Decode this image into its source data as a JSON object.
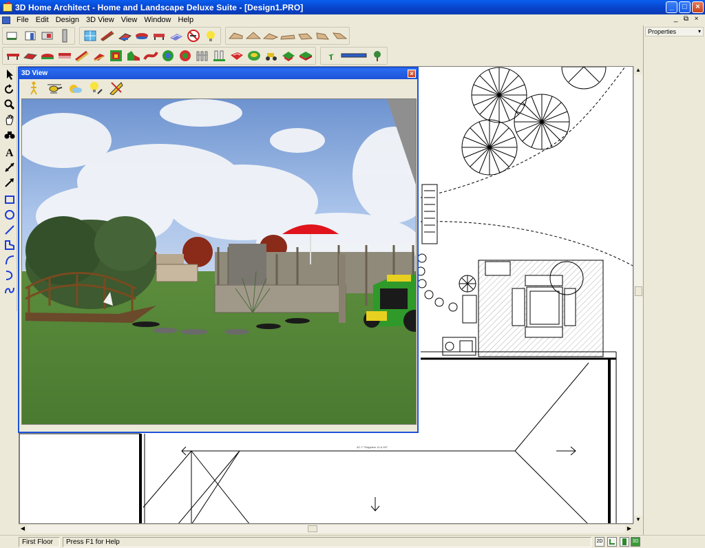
{
  "window": {
    "title": "3D Home Architect - Home and Landscape Deluxe Suite - [Design1.PRO]",
    "minimize": "_",
    "maximize": "□",
    "close": "×"
  },
  "menu": {
    "items": [
      "File",
      "Edit",
      "Design",
      "3D View",
      "View",
      "Window",
      "Help"
    ],
    "mdi_restore": "⧉",
    "mdi_min": "_",
    "mdi_close": "×"
  },
  "toolbar_row1": {
    "group1": [
      "wall-icon",
      "door-icon",
      "window-icon",
      "stairs-icon"
    ],
    "group2": [
      "window-pane-icon",
      "deck-railing-icon",
      "deck-icon",
      "bench-icon",
      "table-icon",
      "paver-icon",
      "no-smoking-icon",
      "light-icon"
    ],
    "group3": [
      "roof-plane-1-icon",
      "roof-plane-2-icon",
      "roof-plane-3-icon",
      "roof-plane-4-icon",
      "roof-plane-5-icon",
      "roof-plane-6-icon",
      "roof-plane-7-icon"
    ]
  },
  "toolbar_row2": {
    "group1": [
      "rail-red-icon",
      "rail-red-2-icon",
      "rail-red-3-icon",
      "rail-red-4-icon",
      "deck-stair-icon",
      "deck-stair-2-icon",
      "planting-bed-icon",
      "terrain-icon",
      "path-icon",
      "ground-icon",
      "shrub-icon",
      "fence-icon",
      "picket-fence-icon",
      "rock-icon",
      "globe-icon",
      "tractor-icon",
      "garden-bed-icon",
      "garden-bed-2-icon"
    ],
    "group2": [
      "sprout-icon",
      "blue-bar-icon",
      "tree-icon"
    ]
  },
  "properties": {
    "label": "Properties",
    "dropdown": "▾"
  },
  "palette": [
    "select-arrow-icon",
    "rotate-icon",
    "zoom-icon",
    "pan-hand-icon",
    "binoculars-icon",
    "text-icon",
    "dimension-icon",
    "line-arrow-icon",
    "rectangle-icon",
    "circle-icon",
    "line-icon",
    "polygon-icon",
    "arc-icon",
    "curve-icon",
    "spline-icon"
  ],
  "view3d": {
    "title": "3D View",
    "close": "×",
    "tools": [
      "walk-person-icon",
      "helicopter-icon",
      "sun-icon",
      "lightbulb-icon",
      "ruler-icon"
    ]
  },
  "plan": {
    "dim_label": "40'-7\" Ridgeline 10 & 9'6\""
  },
  "scroll": {
    "up": "▲",
    "down": "▼",
    "left": "◀",
    "right": "▶"
  },
  "status": {
    "floor": "First Floor",
    "help": "Press F1 for Help",
    "view_buttons": [
      "2D",
      "",
      "",
      "3D"
    ]
  },
  "colors": {
    "titlebar": "#0a52dc",
    "sky": "#8fb0e0",
    "grass": "#4f8436",
    "tractor": "#2f9a2a",
    "umbrella": "#e0141c"
  }
}
